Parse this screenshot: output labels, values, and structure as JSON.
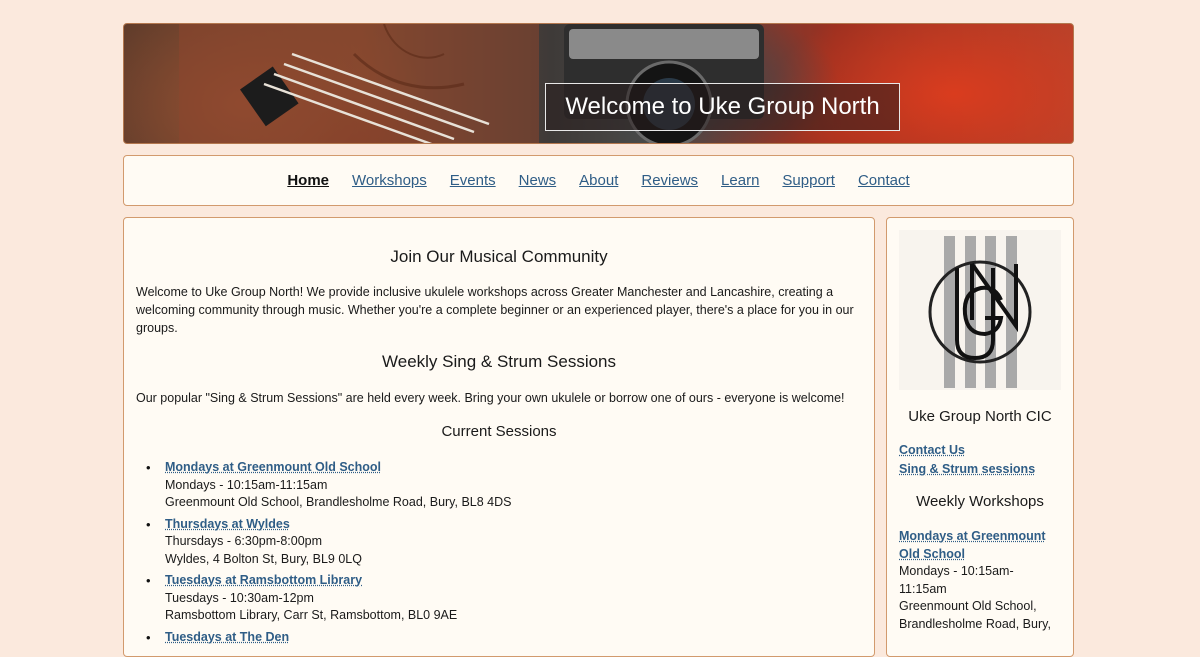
{
  "hero": {
    "title": "Welcome to Uke Group North"
  },
  "nav": {
    "items": [
      {
        "label": "Home",
        "active": true
      },
      {
        "label": "Workshops"
      },
      {
        "label": "Events"
      },
      {
        "label": "News"
      },
      {
        "label": "About"
      },
      {
        "label": "Reviews"
      },
      {
        "label": "Learn"
      },
      {
        "label": "Support"
      },
      {
        "label": "Contact"
      }
    ]
  },
  "main": {
    "heading1": "Join Our Musical Community",
    "intro": "Welcome to Uke Group North! We provide inclusive ukulele workshops across Greater Manchester and Lancashire, creating a welcoming community through music. Whether you're a complete beginner or an experienced player, there's a place for you in our groups.",
    "heading2": "Weekly Sing & Strum Sessions",
    "sessions_text": "Our popular \"Sing & Strum Sessions\" are held every week. Bring your own ukulele or borrow one of ours - everyone is welcome!",
    "heading3": "Current Sessions",
    "sessions": [
      {
        "title": "Mondays at Greenmount Old School",
        "time": "Mondays - 10:15am-11:15am",
        "address": "Greenmount Old School, Brandlesholme Road, Bury, BL8 4DS"
      },
      {
        "title": "Thursdays at Wyldes",
        "time": "Thursdays - 6:30pm-8:00pm",
        "address": "Wyldes, 4 Bolton St, Bury, BL9 0LQ"
      },
      {
        "title": "Tuesdays at Ramsbottom Library",
        "time": "Tuesdays - 10:30am-12pm",
        "address": "Ramsbottom Library, Carr St, Ramsbottom, BL0 9AE"
      },
      {
        "title": "Tuesdays at The Den",
        "time": "",
        "address": ""
      }
    ]
  },
  "sidebar": {
    "org_name": "Uke Group North CIC",
    "links": [
      "Contact Us",
      "Sing & Strum sessions"
    ],
    "workshops_heading": "Weekly Workshops",
    "workshop": {
      "title": "Mondays at Greenmount Old School",
      "time": "Mondays - 10:15am-11:15am",
      "address": "Greenmount Old School, Brandlesholme Road, Bury,"
    }
  },
  "colors": {
    "page_bg": "#fbe9dd",
    "panel_bg": "#fffbf4",
    "border": "#d29a6d",
    "link": "#2f5d86"
  }
}
